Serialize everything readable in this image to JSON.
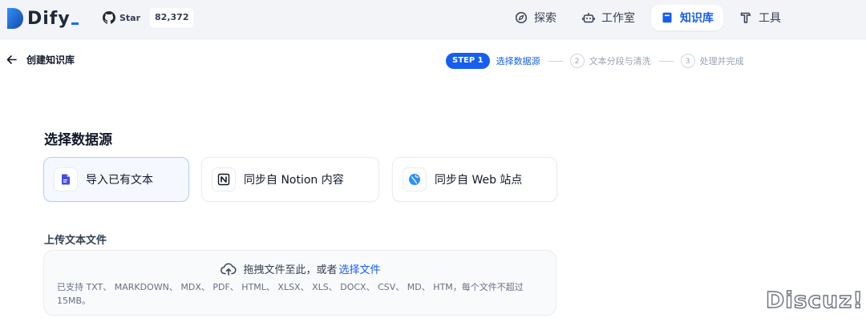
{
  "app": {
    "name": "Dify"
  },
  "github": {
    "star_label": "Star",
    "star_count": "82,372"
  },
  "nav": {
    "items": [
      {
        "label": "探索",
        "icon": "compass-icon"
      },
      {
        "label": "工作室",
        "icon": "robot-icon"
      },
      {
        "label": "知识库",
        "icon": "book-icon",
        "active": true
      },
      {
        "label": "工具",
        "icon": "hammer-icon"
      }
    ]
  },
  "subheader": {
    "back_label": "创建知识库",
    "steps": [
      {
        "badge": "STEP 1",
        "label": "选择数据源",
        "active": true
      },
      {
        "num": "2",
        "label": "文本分段与清洗"
      },
      {
        "num": "3",
        "label": "处理并完成"
      }
    ]
  },
  "main": {
    "section_title": "选择数据源",
    "sources": [
      {
        "label": "导入已有文本",
        "icon": "file-icon",
        "selected": true
      },
      {
        "label": "同步自 Notion 内容",
        "icon": "notion-icon"
      },
      {
        "label": "同步自 Web 站点",
        "icon": "web-icon"
      }
    ],
    "upload": {
      "title": "上传文本文件",
      "drop_text": "拖拽文件至此，或者",
      "drop_link": "选择文件",
      "tip": "已支持 TXT、 MARKDOWN、 MDX、 PDF、 HTML、 XLSX、 XLS、 DOCX、 CSV、 MD、 HTM，每个文件不超过 15MB。"
    }
  },
  "watermark": "Discuz!",
  "colors": {
    "accent": "#155eef",
    "logo_blue": "#1570ef",
    "topbar_bg": "#f2f4f7"
  }
}
